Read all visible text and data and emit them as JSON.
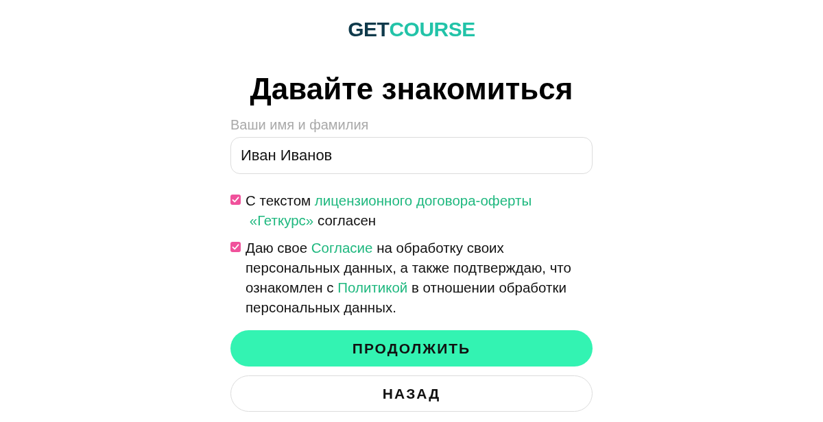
{
  "logo": {
    "parts": [
      {
        "text": "GET",
        "color": "#0f3a4b"
      },
      {
        "text": "COURSE",
        "color": "#22c3a8"
      }
    ]
  },
  "heading": "Давайте знакомиться",
  "name_field": {
    "label": "Ваши имя и фамилия",
    "value": "Иван Иванов"
  },
  "consents": [
    {
      "checked": true,
      "segments": [
        {
          "kind": "text",
          "text": "С текстом "
        },
        {
          "kind": "link",
          "text": "лицензионного договора-оферты"
        },
        {
          "kind": "link",
          "text": "«Геткурс»"
        },
        {
          "kind": "text",
          "text": " согласен"
        }
      ]
    },
    {
      "checked": true,
      "segments": [
        {
          "kind": "text",
          "text": "Даю свое "
        },
        {
          "kind": "link",
          "text": "Согласие"
        },
        {
          "kind": "text",
          "text": " на обработку своих персональных данных, а также подтверждаю, что ознакомлен с "
        },
        {
          "kind": "link",
          "text": "Политикой"
        },
        {
          "kind": "text",
          "text": " в отношении обработки персональных данных."
        }
      ]
    }
  ],
  "buttons": [
    {
      "kind": "primary",
      "label": "ПРОДОЛЖИТЬ"
    },
    {
      "kind": "secondary",
      "label": "НАЗАД"
    }
  ]
}
